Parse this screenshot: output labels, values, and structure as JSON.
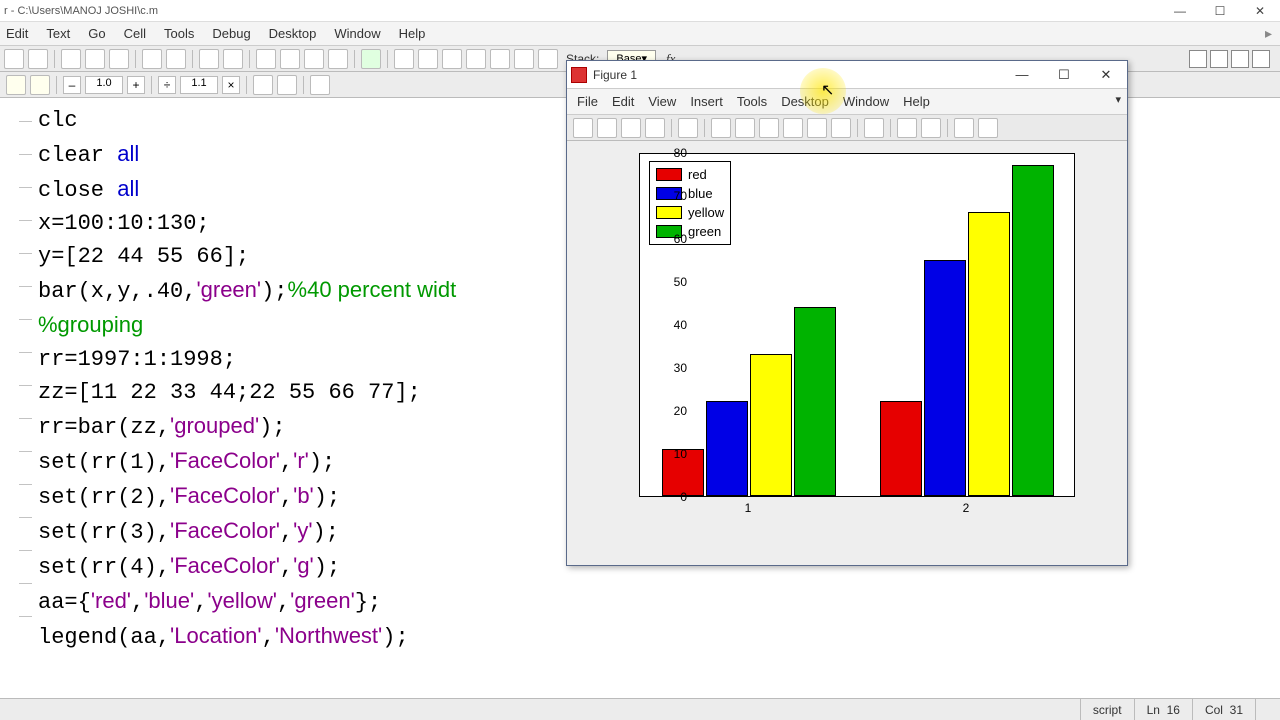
{
  "window": {
    "title": "r - C:\\Users\\MANOJ JOSHI\\c.m"
  },
  "menubar": {
    "items": [
      "Edit",
      "Text",
      "Go",
      "Cell",
      "Tools",
      "Debug",
      "Desktop",
      "Window",
      "Help"
    ]
  },
  "toolbar": {
    "stack_label": "Stack:",
    "stack_value": "Base"
  },
  "zoom": {
    "dec": "–",
    "val1": "1.0",
    "inc": "+",
    "div": "÷",
    "val2": "1.1",
    "close": "×"
  },
  "code_lines": [
    {
      "t": "clc",
      "cls": ""
    },
    {
      "t": "clear <kw>all</kw>",
      "cls": ""
    },
    {
      "t": "close <kw>all</kw>",
      "cls": ""
    },
    {
      "t": "x=100:10:130;",
      "cls": ""
    },
    {
      "t": "y=[22 44 55 66];",
      "cls": ""
    },
    {
      "t": "bar(x,y,.40,<str>'green'</str>);<com>%40 percent widt</com>",
      "cls": ""
    },
    {
      "t": "<com>%grouping</com>",
      "cls": ""
    },
    {
      "t": "rr=1997:1:1998;",
      "cls": ""
    },
    {
      "t": "zz=[11 22 33 44;22 55 66 77];",
      "cls": ""
    },
    {
      "t": "rr=bar(zz,<str>'grouped'</str>);",
      "cls": ""
    },
    {
      "t": "set(rr(1),<str>'FaceColor'</str>,<str>'r'</str>);",
      "cls": ""
    },
    {
      "t": "set(rr(2),<str>'FaceColor'</str>,<str>'b'</str>);",
      "cls": ""
    },
    {
      "t": "set(rr(3),<str>'FaceColor'</str>,<str>'y'</str>);",
      "cls": ""
    },
    {
      "t": "set(rr(4),<str>'FaceColor'</str>,<str>'g'</str>);",
      "cls": ""
    },
    {
      "t": "aa={<str>'red'</str>,<str>'blue'</str>,<str>'yellow'</str>,<str>'green'</str>};",
      "cls": ""
    },
    {
      "t": "legend(aa,<str>'Location'</str>,<str>'Northwest'</str>);",
      "cls": ""
    }
  ],
  "figure": {
    "title": "Figure 1",
    "menus": [
      "File",
      "Edit",
      "View",
      "Insert",
      "Tools",
      "Desktop",
      "Window",
      "Help"
    ]
  },
  "chart_data": {
    "type": "bar",
    "categories": [
      "1",
      "2"
    ],
    "series": [
      {
        "name": "red",
        "color": "#e60000",
        "values": [
          11,
          22
        ]
      },
      {
        "name": "blue",
        "color": "#0000e6",
        "values": [
          22,
          55
        ]
      },
      {
        "name": "yellow",
        "color": "#ffff00",
        "values": [
          33,
          66
        ]
      },
      {
        "name": "green",
        "color": "#00b300",
        "values": [
          44,
          77
        ]
      }
    ],
    "ylim": [
      0,
      80
    ],
    "yticks": [
      0,
      10,
      20,
      30,
      40,
      50,
      60,
      70,
      80
    ],
    "legend_position": "Northwest"
  },
  "status": {
    "mode": "script",
    "line_label": "Ln",
    "line": "16",
    "col_label": "Col",
    "col": "31"
  }
}
